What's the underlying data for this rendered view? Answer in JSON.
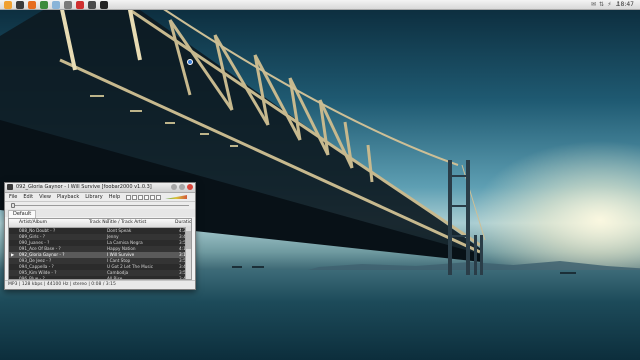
{
  "desktop": {
    "launcher": [
      {
        "icon": "gnome-foot-icon",
        "color": "#f0a030"
      },
      {
        "icon": "terminal-icon",
        "color": "#3a3a3a"
      },
      {
        "icon": "firefox-icon",
        "color": "#e66c1f"
      },
      {
        "icon": "chrome-icon",
        "color": "#3c8b3c"
      },
      {
        "icon": "text-editor-icon",
        "color": "#8ab4d8"
      },
      {
        "icon": "image-viewer-icon",
        "color": "#7a7a7a"
      },
      {
        "icon": "media-player-icon",
        "color": "#cf3030"
      },
      {
        "icon": "camera-icon",
        "color": "#4a4a4a"
      },
      {
        "icon": "foobar-icon",
        "color": "#222222"
      }
    ],
    "tray_icons": [
      "mail-icon",
      "network-icon",
      "power-icon",
      "volume-icon",
      "chat-icon"
    ],
    "clock": "18:47"
  },
  "window": {
    "title": "092_Gloria Gaynor - I Will Survive   [foobar2000 v1.0.3]",
    "menu": [
      "File",
      "Edit",
      "View",
      "Playback",
      "Library",
      "Help"
    ],
    "tab": "Default",
    "columns": {
      "artist": "Artist/Album",
      "trackno": "Track No",
      "title": "Title / Track Artist",
      "duration": "Duration"
    },
    "rows": [
      {
        "artist": "088_No Doubt - ?",
        "title": "Dont Speak",
        "duration": "4:24"
      },
      {
        "artist": "089_Girls - ?",
        "title": "Jenny",
        "duration": "3:46"
      },
      {
        "artist": "090_Juanes - ?",
        "title": "La Camisa Negra",
        "duration": "3:55"
      },
      {
        "artist": "091_Ace Of Base - ?",
        "title": "Happy Nation",
        "duration": "4:13"
      },
      {
        "artist": "092_Gloria Gaynor - ?",
        "title": "I Will Survive",
        "duration": "3:15",
        "selected": true
      },
      {
        "artist": "093_De Jeez - ?",
        "title": "I Cant Stop",
        "duration": "3:55"
      },
      {
        "artist": "094_Cappella - ?",
        "title": "U Got 2 Let The Music",
        "duration": "3:43"
      },
      {
        "artist": "095_Kim Wilde - ?",
        "title": "Cambodja",
        "duration": "3:55"
      },
      {
        "artist": "096_Blue - ?",
        "title": "All Rise",
        "duration": "3:43"
      },
      {
        "artist": "097_ - ?",
        "title": "",
        "duration": ""
      }
    ],
    "status": "MP3 | 128 kbps | 44100 Hz | stereo | 0:08 / 3:15"
  }
}
